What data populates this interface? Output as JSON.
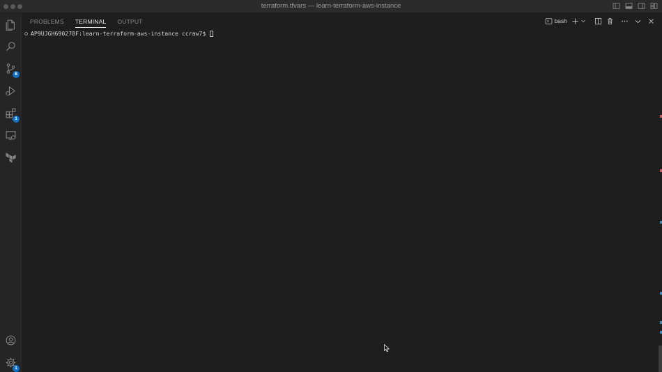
{
  "window": {
    "title": "terraform.tfvars — learn-terraform-aws-instance"
  },
  "activity_bar": {
    "items": [
      {
        "icon": "files-icon"
      },
      {
        "icon": "search-icon"
      },
      {
        "icon": "source-control-icon",
        "badge": "8"
      },
      {
        "icon": "run-debug-icon"
      },
      {
        "icon": "extensions-icon",
        "badge": "1"
      },
      {
        "icon": "remote-explorer-icon"
      },
      {
        "icon": "terraform-icon"
      }
    ],
    "bottom": [
      {
        "icon": "account-icon"
      },
      {
        "icon": "settings-gear-icon",
        "badge": "1"
      }
    ]
  },
  "panel": {
    "tabs": [
      {
        "label": "PROBLEMS",
        "active": false
      },
      {
        "label": "TERMINAL",
        "active": true
      },
      {
        "label": "OUTPUT",
        "active": false
      }
    ],
    "shell": "bash"
  },
  "terminal": {
    "prompt": "AP9UJGH690278F:learn-terraform-aws-instance ccraw7$ "
  },
  "colors": {
    "badge": "#0f72c9",
    "ruler_error": "#e05252",
    "ruler_info": "#2f8fd1"
  }
}
